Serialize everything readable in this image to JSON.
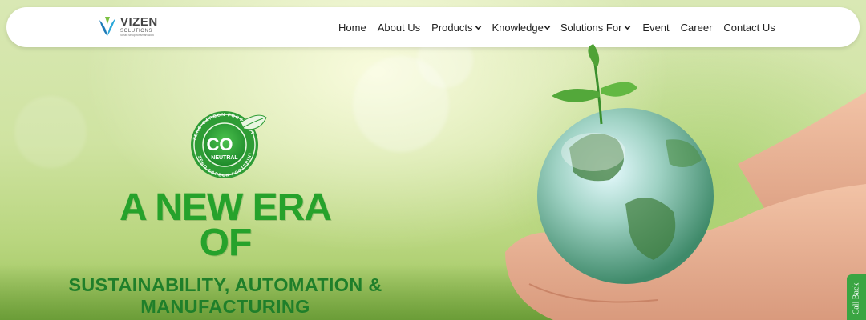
{
  "brand": {
    "name": "VIZEN",
    "subtitle": "SOLUTIONS",
    "tagline": "Smart setup for smart work"
  },
  "nav": {
    "items": [
      {
        "label": "Home",
        "dropdown": false
      },
      {
        "label": "About Us",
        "dropdown": false
      },
      {
        "label": "Products",
        "dropdown": true
      },
      {
        "label": "Knowledge",
        "dropdown": true
      },
      {
        "label": "Solutions For",
        "dropdown": true
      },
      {
        "label": "Event",
        "dropdown": false
      },
      {
        "label": "Career",
        "dropdown": false
      },
      {
        "label": "Contact Us",
        "dropdown": false
      }
    ]
  },
  "badge": {
    "co_text": "CO",
    "neutral_text": "NEUTRAL",
    "ring_text": "ZERO CARBON FOOTPRINT",
    "icon": "leaf-icon"
  },
  "hero": {
    "headline_line1": "A NEW ERA",
    "headline_line2": "OF",
    "subline1": "SUSTAINABILITY, AUTOMATION &",
    "subline2": "MANUFACTURING"
  },
  "callback": {
    "label": "Call Back"
  },
  "colors": {
    "accent": "#26a22b",
    "accent_dark": "#1f7f2a",
    "nav_text": "#222222",
    "callback_bg": "#3aa542"
  }
}
